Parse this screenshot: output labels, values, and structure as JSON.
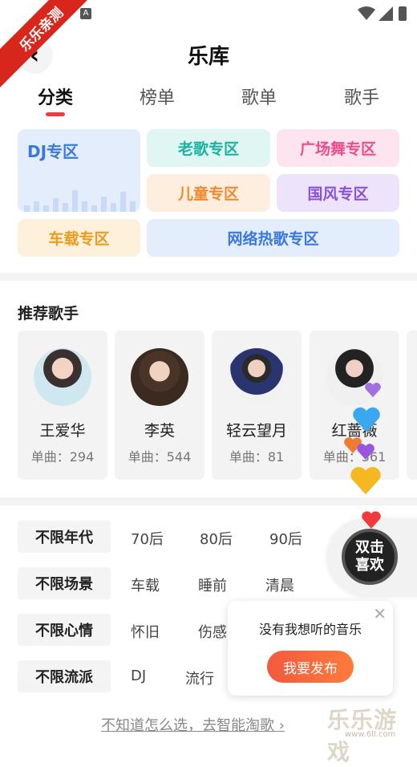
{
  "ribbon": "乐乐亲测",
  "header": {
    "title": "乐库",
    "back_icon": "chevron-left-icon"
  },
  "tabs": [
    {
      "label": "分类",
      "active": true
    },
    {
      "label": "榜单",
      "active": false
    },
    {
      "label": "歌单",
      "active": false
    },
    {
      "label": "歌手",
      "active": false
    }
  ],
  "categories": [
    {
      "label": "DJ专区",
      "color": "#3a78e0",
      "bg": "#e4edfb"
    },
    {
      "label": "老歌专区",
      "color": "#1bb3a0",
      "bg": "#dff6f2"
    },
    {
      "label": "广场舞专区",
      "color": "#ea4e8c",
      "bg": "#fde4ee"
    },
    {
      "label": "儿童专区",
      "color": "#f08a2a",
      "bg": "#fdeee0"
    },
    {
      "label": "国风专区",
      "color": "#8a52d9",
      "bg": "#ede3fb"
    },
    {
      "label": "车载专区",
      "color": "#ef9a1c",
      "bg": "#fdf1dc"
    },
    {
      "label": "网络热歌专区",
      "color": "#3a78e0",
      "bg": "#e4edfb"
    }
  ],
  "singers_section": {
    "title": "推荐歌手"
  },
  "singers": [
    {
      "name": "王爱华",
      "count": "单曲：294"
    },
    {
      "name": "李英",
      "count": "单曲：544"
    },
    {
      "name": "轻云望月",
      "count": "单曲：81"
    },
    {
      "name": "红蔷薇",
      "count": "单曲：361"
    }
  ],
  "filters": [
    {
      "label": "不限年代",
      "options": [
        "70后",
        "80后",
        "90后"
      ]
    },
    {
      "label": "不限场景",
      "options": [
        "车载",
        "睡前",
        "清晨"
      ]
    },
    {
      "label": "不限心情",
      "options": [
        "怀旧",
        "伤感"
      ]
    },
    {
      "label": "不限流派",
      "options": [
        "DJ",
        "流行"
      ]
    }
  ],
  "popup": {
    "text": "没有我想听的音乐",
    "button": "我要发布"
  },
  "like_button": {
    "line1": "双击",
    "line2": "喜欢"
  },
  "hint": "不知道怎么选，去智能淘歌 ›",
  "watermark": {
    "text": "乐乐游戏",
    "url": "www.6ll.com"
  }
}
